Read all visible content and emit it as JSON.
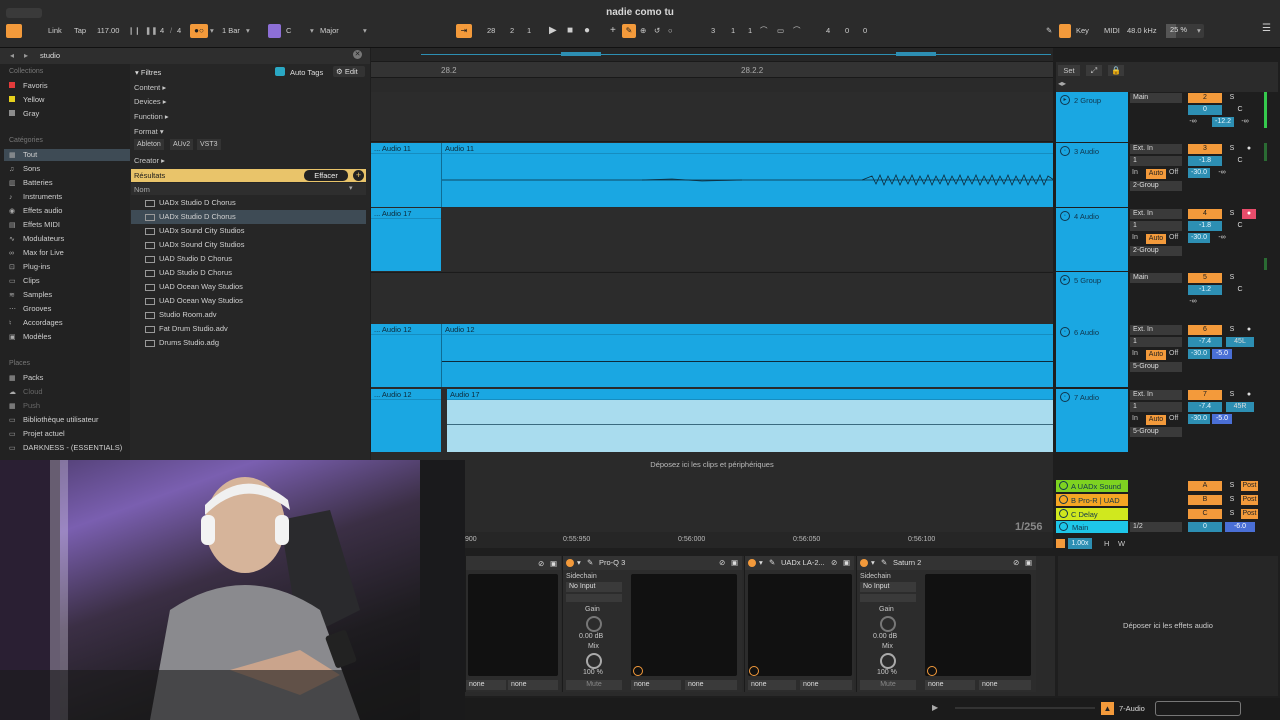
{
  "window_title": "nadie como tu",
  "transport": {
    "link": "Link",
    "tap": "Tap",
    "tempo": "117.00",
    "time_sig_num": "4",
    "time_sig_den": "4",
    "quantize": "1 Bar",
    "key": "C",
    "scale": "Major",
    "position_bar": "28",
    "position_beat": "2",
    "position_sixteenth": "1",
    "loop_start_bar": "3",
    "loop_start_beat": "1",
    "loop_start_sixteenth": "1",
    "loop_length_bar": "4",
    "loop_length_beat": "0",
    "loop_length_sixteenth": "0",
    "key_map": "Key",
    "midi_map": "MIDI",
    "sample_rate": "48.0 kHz",
    "cpu": "25 %"
  },
  "browser": {
    "search": "studio",
    "filters_label": "Filtres",
    "auto_tags": "Auto Tags",
    "edit": "Edit",
    "filter_rows": [
      "Content ▸",
      "Devices ▸",
      "Function ▸",
      "Format ▾"
    ],
    "format_tags": [
      "Ableton",
      "AUv2",
      "VST3"
    ],
    "creator": "Creator ▸",
    "results_label": "Résultats",
    "clear_label": "Effacer",
    "name_col": "Nom",
    "results": [
      "UADx Studio D Chorus",
      "UADx Studio D Chorus",
      "UADx Sound City Studios",
      "UADx Sound City Studios",
      "UAD Studio D Chorus",
      "UAD Studio D Chorus",
      "UAD Ocean Way Studios",
      "UAD Ocean Way Studios",
      "Studio Room.adv",
      "Fat Drum Studio.adv",
      "Drums Studio.adg"
    ],
    "selected_result_index": 1
  },
  "sidebar": {
    "collections_label": "Collections",
    "collections": [
      {
        "label": "Favoris",
        "color": "#e33b3b"
      },
      {
        "label": "Yellow",
        "color": "#e6d11d"
      },
      {
        "label": "Gray",
        "color": "#8c8c8c"
      }
    ],
    "categories_label": "Catégories",
    "categories": [
      "Tout",
      "Sons",
      "Batteries",
      "Instruments",
      "Effets audio",
      "Effets MIDI",
      "Modulateurs",
      "Max for Live",
      "Plug-ins",
      "Clips",
      "Samples",
      "Grooves",
      "Accordages",
      "Modèles"
    ],
    "places_label": "Places",
    "places": [
      "Packs",
      "Cloud",
      "Push",
      "Bibliothèque utilisateur",
      "Projet actuel",
      "DARKNESS - (ESSENTIALS)"
    ]
  },
  "arrangement": {
    "ruler_marks": [
      "28.2",
      "28.2.2"
    ],
    "set_label": "Set",
    "drop_hint": "Déposez ici les clips et périphériques",
    "time_marks": [
      "900",
      "0:55:950",
      "0:56:000",
      "0:56:050",
      "0:56:100"
    ],
    "zoom": "1/256",
    "clips": [
      {
        "left_label": "... Audio 11",
        "label": "Audio 11"
      },
      {
        "left_label": "... Audio 17",
        "label": ""
      },
      {
        "left_label": "... Audio 12",
        "label": "Audio 12"
      },
      {
        "left_label": "... Audio 12",
        "label": "Audio 17"
      }
    ]
  },
  "tracks": [
    {
      "name": "2 Group",
      "route": "Main",
      "num": "2",
      "vol": "0",
      "pan": "C",
      "peak": "-12.2",
      "inf": "-∞"
    },
    {
      "name": "3 Audio",
      "route": "Ext. In",
      "chan": "1",
      "num": "3",
      "vol": "-1.8",
      "pan": "C",
      "send": "-30.0",
      "inf": "-∞",
      "group": "2-Group",
      "mon_in": "In",
      "mon_auto": "Auto",
      "mon_off": "Off"
    },
    {
      "name": "4 Audio",
      "route": "Ext. In",
      "chan": "1",
      "num": "4",
      "vol": "-1.8",
      "pan": "C",
      "send": "-30.0",
      "inf": "-∞",
      "group": "2-Group",
      "mon_in": "In",
      "mon_auto": "Auto",
      "mon_off": "Off"
    },
    {
      "name": "5 Group",
      "route": "Main",
      "num": "5",
      "vol": "-1.2",
      "pan": "C",
      "inf": "-∞"
    },
    {
      "name": "6 Audio",
      "route": "Ext. In",
      "chan": "1",
      "num": "6",
      "vol": "-7.4",
      "pan": "45L",
      "send": "-30.0",
      "send2": "-5.0",
      "group": "5-Group",
      "mon_in": "In",
      "mon_auto": "Auto",
      "mon_off": "Off"
    },
    {
      "name": "7 Audio",
      "route": "Ext. In",
      "chan": "1",
      "num": "7",
      "vol": "-7.4",
      "pan": "45R",
      "send": "-30.0",
      "send2": "-5.0",
      "group": "5-Group",
      "mon_in": "In",
      "mon_auto": "Auto",
      "mon_off": "Off"
    }
  ],
  "returns": [
    {
      "name": "A UADx Sound",
      "letter": "A",
      "solo": "S",
      "post": "Post",
      "color": "#7ed321"
    },
    {
      "name": "B Pro-R | UAD",
      "letter": "B",
      "solo": "S",
      "post": "Post",
      "color": "#f5a623"
    },
    {
      "name": "C Delay",
      "letter": "C",
      "solo": "S",
      "post": "Post",
      "color": "#d0e81e"
    }
  ],
  "main": {
    "name": "Main",
    "chan": "1/2",
    "vol": "0",
    "vol2": "-6.0",
    "zoom": "1.00x",
    "h": "H",
    "w": "W"
  },
  "devices": {
    "proq": "Pro-Q 3",
    "la2": "UADx LA-2...",
    "saturn": "Saturn 2",
    "sidechain": "Sidechain",
    "no_input": "No Input",
    "gain": "Gain",
    "gain_val": "0.00 dB",
    "mix": "Mix",
    "mix_val": "100 %",
    "mute": "Mute",
    "none": "none",
    "drop_fx": "Déposer ici les effets audio"
  },
  "status": {
    "track": "7-Audio"
  }
}
